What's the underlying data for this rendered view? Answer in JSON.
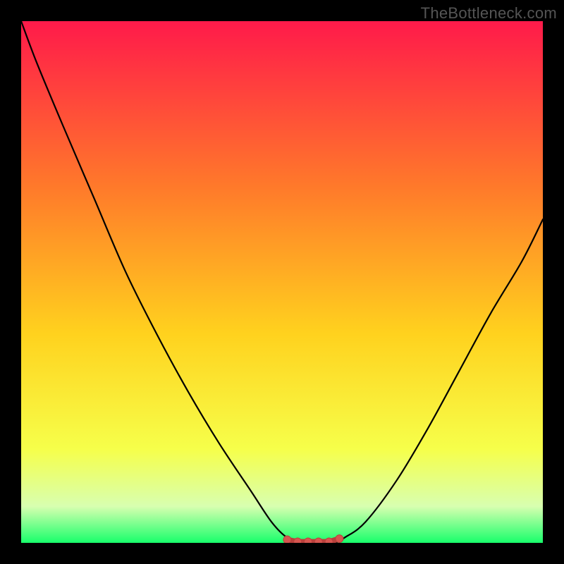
{
  "watermark": "TheBottleneck.com",
  "colors": {
    "bg": "#000000",
    "grad_top": "#ff1a4a",
    "grad_mid1": "#ff7a2a",
    "grad_mid2": "#ffd21e",
    "grad_mid3": "#f6ff4a",
    "grad_bottom": "#18ff6b",
    "near_bottom_band": "#d8ffb0",
    "curve": "#000000",
    "marker_fill": "#d6554f",
    "marker_stroke": "#b9413c"
  },
  "chart_data": {
    "type": "line",
    "title": "",
    "xlabel": "",
    "ylabel": "",
    "xlim": [
      0,
      100
    ],
    "ylim": [
      0,
      100
    ],
    "grid": false,
    "legend": false,
    "series": [
      {
        "name": "bottleneck-curve",
        "x": [
          0,
          3,
          8,
          14,
          20,
          26,
          32,
          38,
          44,
          48,
          51,
          54,
          57,
          60,
          62,
          66,
          72,
          78,
          84,
          90,
          96,
          100
        ],
        "y": [
          100,
          92,
          80,
          66,
          52,
          40,
          29,
          19,
          10,
          4,
          1,
          0,
          0,
          0,
          1,
          4,
          12,
          22,
          33,
          44,
          54,
          62
        ]
      }
    ],
    "markers": {
      "name": "optimal-zone",
      "x": [
        51,
        53,
        55,
        57,
        59,
        61
      ],
      "y": [
        0.6,
        0.2,
        0.2,
        0.2,
        0.2,
        0.8
      ]
    },
    "annotations": []
  }
}
